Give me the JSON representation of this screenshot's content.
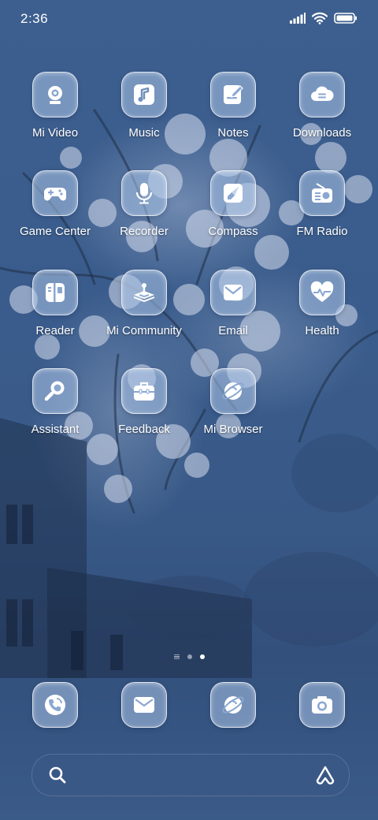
{
  "status_bar": {
    "time": "2:36",
    "icons": [
      "signal-icon",
      "wifi-icon",
      "battery-icon"
    ]
  },
  "apps": [
    {
      "label": "Mi Video",
      "icon": "mi-video-icon"
    },
    {
      "label": "Music",
      "icon": "music-icon"
    },
    {
      "label": "Notes",
      "icon": "notes-icon"
    },
    {
      "label": "Downloads",
      "icon": "downloads-icon"
    },
    {
      "label": "Game Center",
      "icon": "gamepad-icon"
    },
    {
      "label": "Recorder",
      "icon": "microphone-icon"
    },
    {
      "label": "Compass",
      "icon": "compass-icon"
    },
    {
      "label": "FM Radio",
      "icon": "radio-icon"
    },
    {
      "label": "Reader",
      "icon": "book-icon"
    },
    {
      "label": "Mi Community",
      "icon": "community-icon"
    },
    {
      "label": "Email",
      "icon": "mail-icon"
    },
    {
      "label": "Health",
      "icon": "heart-icon"
    },
    {
      "label": "Assistant",
      "icon": "magnifier-icon"
    },
    {
      "label": "Feedback",
      "icon": "briefcase-icon"
    },
    {
      "label": "Mi Browser",
      "icon": "planet-icon"
    }
  ],
  "page_indicator": {
    "pages": 3,
    "active": 2
  },
  "dock": [
    {
      "icon": "phone-icon"
    },
    {
      "icon": "messages-icon"
    },
    {
      "icon": "browser-icon"
    },
    {
      "icon": "camera-icon"
    }
  ],
  "search_bar": {
    "left_icon": "search-icon",
    "right_icon": "assistant-icon"
  },
  "colors": {
    "wallpaper": "#3a5c8c",
    "icon_tile": "#aac3e6",
    "glyph": "#ffffff"
  }
}
